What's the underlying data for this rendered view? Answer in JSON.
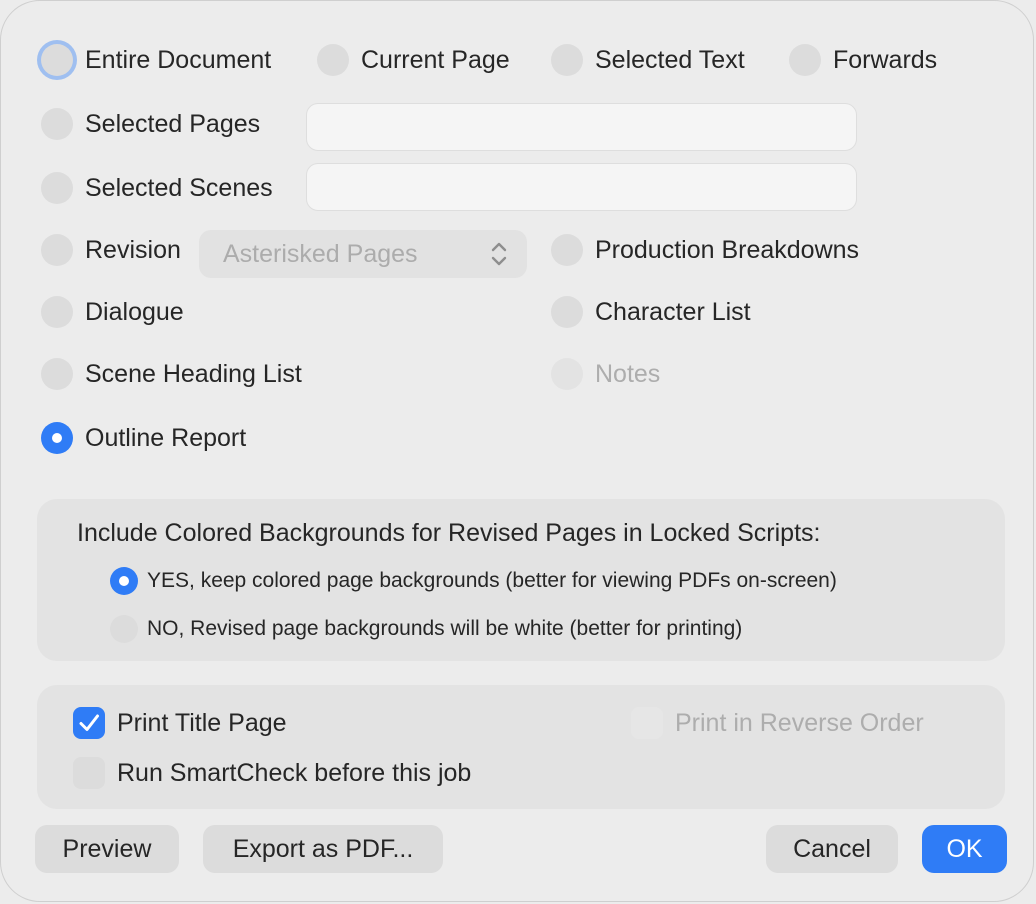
{
  "scope": {
    "entire_document": "Entire Document",
    "current_page": "Current Page",
    "selected_text": "Selected Text",
    "forwards": "Forwards",
    "selected_pages": "Selected Pages",
    "selected_pages_value": "",
    "selected_scenes": "Selected Scenes",
    "selected_scenes_value": "",
    "revision": "Revision",
    "revision_popup_value": "Asterisked Pages",
    "production_breakdowns": "Production Breakdowns",
    "dialogue": "Dialogue",
    "character_list": "Character List",
    "scene_heading_list": "Scene Heading List",
    "notes": "Notes",
    "outline_report": "Outline Report",
    "selected": "outline_report"
  },
  "backgrounds": {
    "heading": "Include Colored Backgrounds for Revised Pages in Locked Scripts:",
    "yes_label": "YES, keep colored page backgrounds (better for viewing PDFs on-screen)",
    "no_label": "NO, Revised page backgrounds will be white (better for printing)",
    "selected": "yes"
  },
  "options": {
    "print_title_page": "Print Title Page",
    "print_title_page_checked": true,
    "print_reverse_order": "Print in Reverse Order",
    "print_reverse_order_checked": false,
    "run_smartcheck": "Run SmartCheck before this job",
    "run_smartcheck_checked": false
  },
  "buttons": {
    "preview": "Preview",
    "export_pdf": "Export as PDF...",
    "cancel": "Cancel",
    "ok": "OK"
  },
  "colors": {
    "accent": "#2f7cf6",
    "background": "#ececec"
  }
}
